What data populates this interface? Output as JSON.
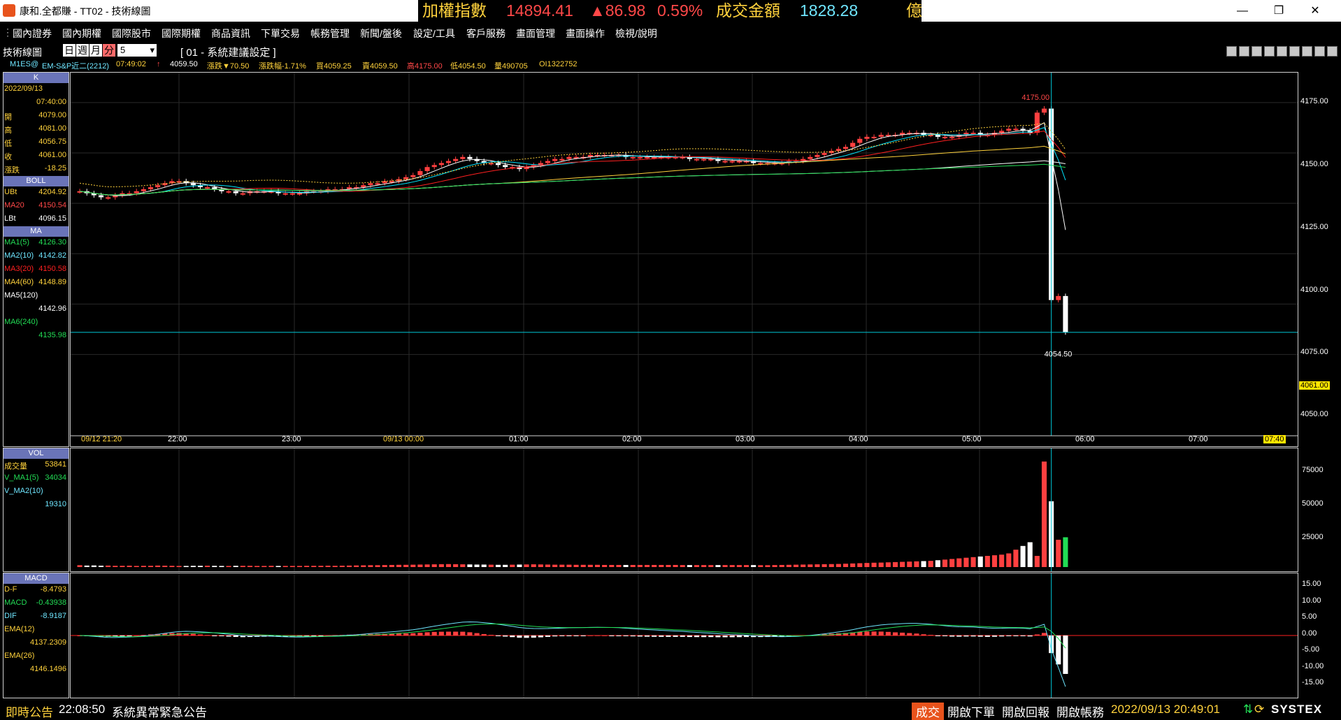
{
  "window": {
    "title": "康和.全都賺 - TT02 - 技術線圖",
    "controls": {
      "minimize": "—",
      "maximize": "❐",
      "close": "✕"
    }
  },
  "ticker": {
    "index_label": "加權指數",
    "index_value": "14894.41",
    "change": "▲86.98",
    "change_pct": "0.59%",
    "amount_label": "成交金額",
    "amount_value": "1828.28",
    "amount_unit": "億"
  },
  "menu": [
    "國內證券",
    "國內期權",
    "國際股市",
    "國際期權",
    "商品資訊",
    "下單交易",
    "帳務管理",
    "新聞/盤後",
    "設定/工具",
    "客戶服務",
    "畫面管理",
    "畫面操作",
    "檢視/說明"
  ],
  "toolbar": {
    "label": "技術線圖",
    "periods": [
      "日",
      "週",
      "月",
      "分"
    ],
    "active_period": "分",
    "interval": "5",
    "setting": "[ 01 - 系統建議設定 ]"
  },
  "quote": {
    "symbol": "M1ES@",
    "name": "EM-S&P近二(2212)",
    "time": "07:49:02",
    "arrow": "↑",
    "price": "4059.50",
    "change": "漲跌▼70.50",
    "change_pct": "漲跌幅-1.71%",
    "bid": "買4059.25",
    "ask": "賣4059.50",
    "high": "高4175.00",
    "low": "低4054.50",
    "volume": "量490705",
    "oi": "OI1322752"
  },
  "kpanel": {
    "header": "K",
    "date": "2022/09/13",
    "time": "07:40:00",
    "rows": [
      {
        "label": "開",
        "value": "4079.00"
      },
      {
        "label": "高",
        "value": "4081.00"
      },
      {
        "label": "低",
        "value": "4056.75"
      },
      {
        "label": "收",
        "value": "4061.00"
      },
      {
        "label": "漲跌",
        "value": "-18.25"
      }
    ],
    "boll_header": "BOLL",
    "boll": [
      {
        "label": "UBt",
        "value": "4204.92"
      },
      {
        "label": "MA20",
        "value": "4150.54"
      },
      {
        "label": "LBt",
        "value": "4096.15"
      }
    ],
    "ma_header": "MA",
    "ma": [
      {
        "label": "MA1(5)",
        "value": "4126.30"
      },
      {
        "label": "MA2(10)",
        "value": "4142.82"
      },
      {
        "label": "MA3(20)",
        "value": "4150.58"
      },
      {
        "label": "MA4(60)",
        "value": "4148.89"
      },
      {
        "label": "MA5(120)",
        "value": ""
      },
      {
        "label": "",
        "value": "4142.96"
      },
      {
        "label": "MA6(240)",
        "value": ""
      },
      {
        "label": "",
        "value": "4135.98"
      }
    ],
    "price_axis": [
      "4175.00",
      "4150.00",
      "4125.00",
      "4100.00",
      "4075.00",
      "4050.00"
    ],
    "current_price_tag": "4061.00",
    "high_mark": "4175.00",
    "low_mark": "4054.50",
    "time_axis": [
      "09/12 21:20",
      "22:00",
      "23:00",
      "09/13 00:00",
      "01:00",
      "02:00",
      "03:00",
      "04:00",
      "05:00",
      "06:00",
      "07:00",
      "07:40"
    ]
  },
  "volpanel": {
    "header": "VOL",
    "rows": [
      {
        "label": "成交量",
        "value": "53841"
      },
      {
        "label": "V_MA1(5)",
        "value": "34034"
      },
      {
        "label": "V_MA2(10)",
        "value": ""
      },
      {
        "label": "",
        "value": "19310"
      }
    ],
    "axis": [
      "75000",
      "50000",
      "25000"
    ]
  },
  "macdpanel": {
    "header": "MACD",
    "rows": [
      {
        "label": "D-F",
        "value": "-8.4793"
      },
      {
        "label": "MACD",
        "value": "-0.43938"
      },
      {
        "label": "DIF",
        "value": "-8.9187"
      },
      {
        "label": "EMA(12)",
        "value": ""
      },
      {
        "label": "",
        "value": "4137.2309"
      },
      {
        "label": "EMA(26)",
        "value": ""
      },
      {
        "label": "",
        "value": "4146.1496"
      }
    ],
    "axis": [
      "15.00",
      "10.00",
      "5.00",
      "0.00",
      "-5.00",
      "-10.00",
      "-15.00"
    ]
  },
  "status": {
    "notice_label": "即時公告",
    "notice_time": "22:08:50",
    "notice_text": "系統異常緊急公告",
    "deal": "成交",
    "open_order": "開啟下單",
    "open_report": "開啟回報",
    "open_account": "開啟帳務",
    "datetime": "2022/09/13 20:49:01",
    "brand": "SYSTEX"
  },
  "colors": {
    "up": "#ff4040",
    "down": "#ffffff",
    "accent": "#ffd23c",
    "boll": "#ffd23c",
    "ma5": "#ffffff",
    "ma10": "#00e5ff",
    "ma20": "#ff2020",
    "ma60": "#ffd23c",
    "ma120": "#ffffff",
    "ma240": "#22dd55"
  },
  "chart_data": {
    "type": "candlestick",
    "interval_min": 5,
    "ylim": [
      4045,
      4185
    ],
    "volume_ylim": [
      0,
      90000
    ],
    "macd_ylim": [
      -17,
      17
    ],
    "candles_note": "values estimated from chart",
    "close": [
      4131,
      4130,
      4129,
      4128,
      4128,
      4129,
      4130,
      4130,
      4131,
      4132,
      4133,
      4134,
      4135,
      4136,
      4136,
      4135,
      4134,
      4133,
      4133,
      4132,
      4131,
      4131,
      4130,
      4130,
      4131,
      4131,
      4131,
      4131,
      4130,
      4130,
      4130,
      4130,
      4131,
      4131,
      4131,
      4132,
      4132,
      4132,
      4133,
      4133,
      4134,
      4135,
      4135,
      4136,
      4136,
      4137,
      4138,
      4139,
      4141,
      4143,
      4144,
      4145,
      4146,
      4147,
      4148,
      4147,
      4146,
      4145,
      4145,
      4144,
      4143,
      4143,
      4142,
      4143,
      4144,
      4145,
      4146,
      4147,
      4147,
      4148,
      4148,
      4148,
      4149,
      4149,
      4149,
      4149,
      4149,
      4148,
      4148,
      4148,
      4148,
      4148,
      4148,
      4148,
      4148,
      4148,
      4147,
      4147,
      4147,
      4147,
      4146,
      4146,
      4146,
      4146,
      4146,
      4145,
      4145,
      4145,
      4145,
      4145,
      4146,
      4146,
      4147,
      4148,
      4149,
      4150,
      4151,
      4152,
      4153,
      4155,
      4157,
      4158,
      4158,
      4159,
      4159,
      4159,
      4160,
      4160,
      4160,
      4159,
      4159,
      4158,
      4158,
      4158,
      4159,
      4160,
      4160,
      4159,
      4159,
      4160,
      4161,
      4162,
      4162,
      4161,
      4160,
      4170,
      4172,
      4077,
      4079,
      4061
    ],
    "volume_estimate": [
      1500,
      1200,
      1300,
      1100,
      1200,
      1000,
      1000,
      1100,
      900,
      1000,
      1000,
      1200,
      1100,
      1000,
      900,
      900,
      1000,
      1000,
      1100,
      1000,
      900,
      900,
      1000,
      1000,
      1000,
      900,
      900,
      1000,
      900,
      900,
      900,
      900,
      1000,
      1000,
      1000,
      1100,
      1000,
      1100,
      1200,
      1300,
      1400,
      1500,
      1500,
      1600,
      1700,
      1800,
      1800,
      1900,
      2000,
      2100,
      2200,
      2300,
      2400,
      2300,
      2200,
      2100,
      2000,
      2000,
      1900,
      1800,
      1800,
      1900,
      2000,
      2100,
      2200,
      2100,
      2000,
      1900,
      1900,
      1900,
      1800,
      1800,
      1800,
      1800,
      1700,
      1700,
      1700,
      1700,
      1700,
      1700,
      1700,
      1700,
      1700,
      1700,
      1700,
      1600,
      1600,
      1600,
      1600,
      1600,
      1600,
      1600,
      1600,
      1600,
      1600,
      1600,
      1500,
      1500,
      1600,
      1700,
      1800,
      1900,
      2000,
      2100,
      2200,
      2300,
      2400,
      2500,
      2700,
      2900,
      3100,
      3300,
      3500,
      3600,
      3800,
      4000,
      4200,
      4400,
      4600,
      4800,
      5000,
      5500,
      6000,
      6500,
      7000,
      7500,
      8000,
      8500,
      9000,
      9500,
      10000,
      11000,
      14000,
      17000,
      20000,
      9000,
      85000,
      53000,
      22000,
      24000
    ]
  }
}
